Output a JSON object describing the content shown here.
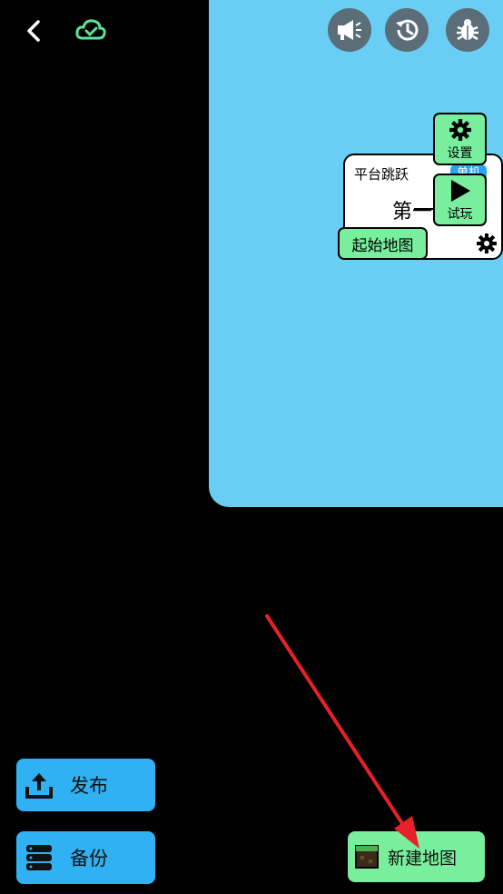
{
  "toolbar": {
    "back_icon": "chevron-left-icon",
    "cloud_icon": "cloud-check-icon",
    "buttons": [
      {
        "icon": "megaphone-icon"
      },
      {
        "icon": "history-icon"
      },
      {
        "icon": "bug-icon"
      }
    ]
  },
  "card": {
    "title": "平台跳跃",
    "badge": "单机",
    "level_text": "第一",
    "settings_label": "设置",
    "play_label": "试玩",
    "start_map_label": "起始地图"
  },
  "sidebar": {
    "publish_label": "发布",
    "backup_label": "备份"
  },
  "bottom": {
    "new_map_label": "新建地图"
  },
  "colors": {
    "canvas": "#6acdf3",
    "green": "#79ef9e",
    "blue_button": "#2fb1f3",
    "circle_button": "#5a6d78",
    "arrow": "#e8202a"
  }
}
